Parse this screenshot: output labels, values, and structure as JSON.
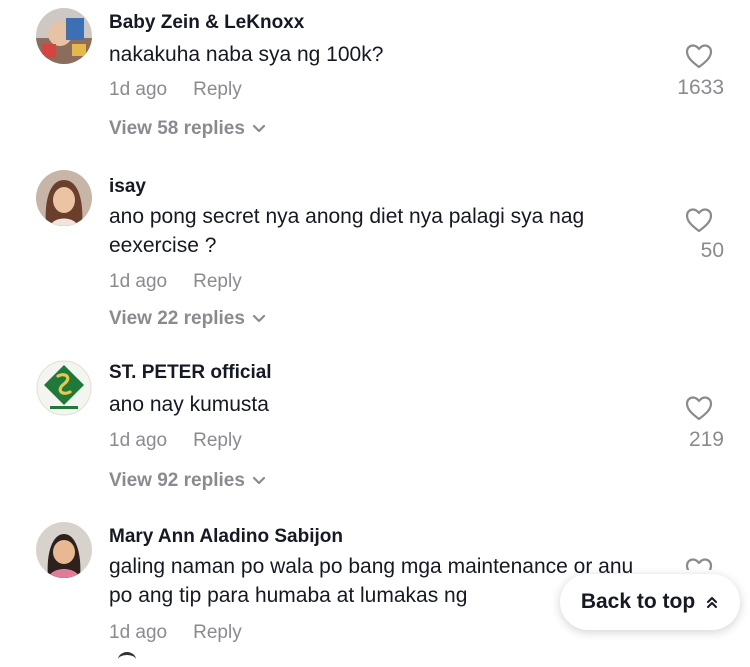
{
  "comments": [
    {
      "username": "Baby Zein & LeKnoxx",
      "text": "nakakuha naba sya ng 100k?",
      "time": "1d ago",
      "reply_label": "Reply",
      "likes": "1633",
      "view_replies": "View 58 replies",
      "avatar_icon": "avatar-photo"
    },
    {
      "username": "isay",
      "text": "ano pong secret nya anong diet nya palagi sya nag eexercise ?",
      "time": "1d ago",
      "reply_label": "Reply",
      "likes": "50",
      "view_replies": "View 22 replies",
      "avatar_icon": "avatar-photo"
    },
    {
      "username": "ST. PETER official",
      "text": "ano nay kumusta",
      "time": "1d ago",
      "reply_label": "Reply",
      "likes": "219",
      "view_replies": "View 92 replies",
      "avatar_icon": "st-peter-logo"
    },
    {
      "username": "Mary Ann Aladino Sabijon",
      "text": "galing naman po wala po bang mga maintenance or anu po ang tip para humaba at lumakas ng",
      "time": "1d ago",
      "reply_label": "Reply",
      "avatar_icon": "avatar-photo"
    }
  ],
  "back_to_top": {
    "label": "Back to top",
    "icon": "double-chevron-up-icon"
  },
  "colors": {
    "primary_text": "#161823",
    "secondary_text": "#8a8b91",
    "background": "#ffffff"
  },
  "icons": {
    "like": "heart-outline-icon",
    "expand": "chevron-down-icon"
  }
}
